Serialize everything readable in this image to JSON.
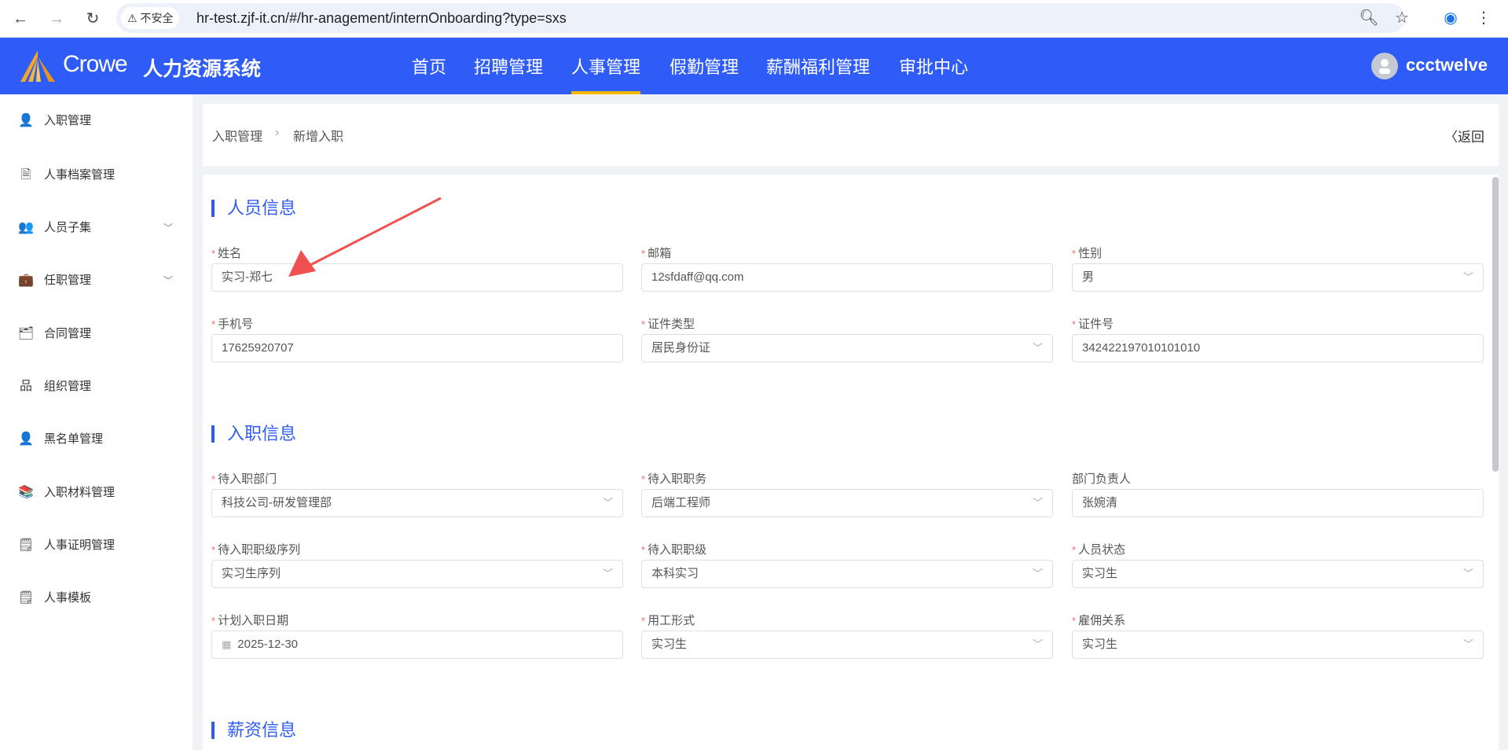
{
  "browser": {
    "security_label": "不安全",
    "url": "hr-test.zjf-it.cn/#/hr-anagement/internOnboarding?type=sxs"
  },
  "header": {
    "brand": "Crowe",
    "system_name": "人力资源系统",
    "nav": [
      "首页",
      "招聘管理",
      "人事管理",
      "假勤管理",
      "薪酬福利管理",
      "审批中心"
    ],
    "active_nav": "人事管理",
    "username": "ccctwelve"
  },
  "sidebar": {
    "items": [
      {
        "label": "入职管理",
        "icon": "user-add-icon",
        "glyph": "👤"
      },
      {
        "label": "人事档案管理",
        "icon": "document-icon",
        "glyph": "🗎"
      },
      {
        "label": "人员子集",
        "icon": "users-icon",
        "glyph": "👥",
        "expandable": true
      },
      {
        "label": "任职管理",
        "icon": "briefcase-icon",
        "glyph": "💼",
        "expandable": true
      },
      {
        "label": "合同管理",
        "icon": "contract-icon",
        "glyph": "🗂"
      },
      {
        "label": "组织管理",
        "icon": "org-chart-icon",
        "glyph": "品"
      },
      {
        "label": "黑名单管理",
        "icon": "user-block-icon",
        "glyph": "👤"
      },
      {
        "label": "入职材料管理",
        "icon": "books-icon",
        "glyph": "📚"
      },
      {
        "label": "人事证明管理",
        "icon": "certificate-icon",
        "glyph": "🗒"
      },
      {
        "label": "人事模板",
        "icon": "template-icon",
        "glyph": "🗒"
      }
    ]
  },
  "breadcrumb": {
    "items": [
      "入职管理",
      "新增入职"
    ],
    "back_label": "返回"
  },
  "form": {
    "sections": [
      {
        "title": "人员信息",
        "fields": [
          {
            "label": "姓名",
            "value": "实习-郑七",
            "required": true,
            "type": "text"
          },
          {
            "label": "邮箱",
            "value": "12sfdaff@qq.com",
            "required": true,
            "type": "text"
          },
          {
            "label": "性别",
            "value": "男",
            "required": true,
            "type": "select"
          },
          {
            "label": "手机号",
            "value": "17625920707",
            "required": true,
            "type": "text"
          },
          {
            "label": "证件类型",
            "value": "居民身份证",
            "required": true,
            "type": "select"
          },
          {
            "label": "证件号",
            "value": "342422197010101010",
            "required": true,
            "type": "text"
          }
        ]
      },
      {
        "title": "入职信息",
        "fields": [
          {
            "label": "待入职部门",
            "value": "科技公司-研发管理部",
            "required": true,
            "type": "select"
          },
          {
            "label": "待入职职务",
            "value": "后端工程师",
            "required": true,
            "type": "select"
          },
          {
            "label": "部门负责人",
            "value": "张婉清",
            "required": false,
            "type": "text"
          },
          {
            "label": "待入职职级序列",
            "value": "实习生序列",
            "required": true,
            "type": "select"
          },
          {
            "label": "待入职职级",
            "value": "本科实习",
            "required": true,
            "type": "select"
          },
          {
            "label": "人员状态",
            "value": "实习生",
            "required": true,
            "type": "select"
          },
          {
            "label": "计划入职日期",
            "value": "2025-12-30",
            "required": true,
            "type": "date"
          },
          {
            "label": "用工形式",
            "value": "实习生",
            "required": true,
            "type": "select"
          },
          {
            "label": "雇佣关系",
            "value": "实习生",
            "required": true,
            "type": "select"
          }
        ]
      },
      {
        "title": "薪资信息",
        "fields": []
      }
    ]
  },
  "colors": {
    "primary": "#2f5cf6",
    "active_underline": "#f5b800",
    "required": "#f56c6c",
    "annotation_arrow": "#f05050"
  }
}
